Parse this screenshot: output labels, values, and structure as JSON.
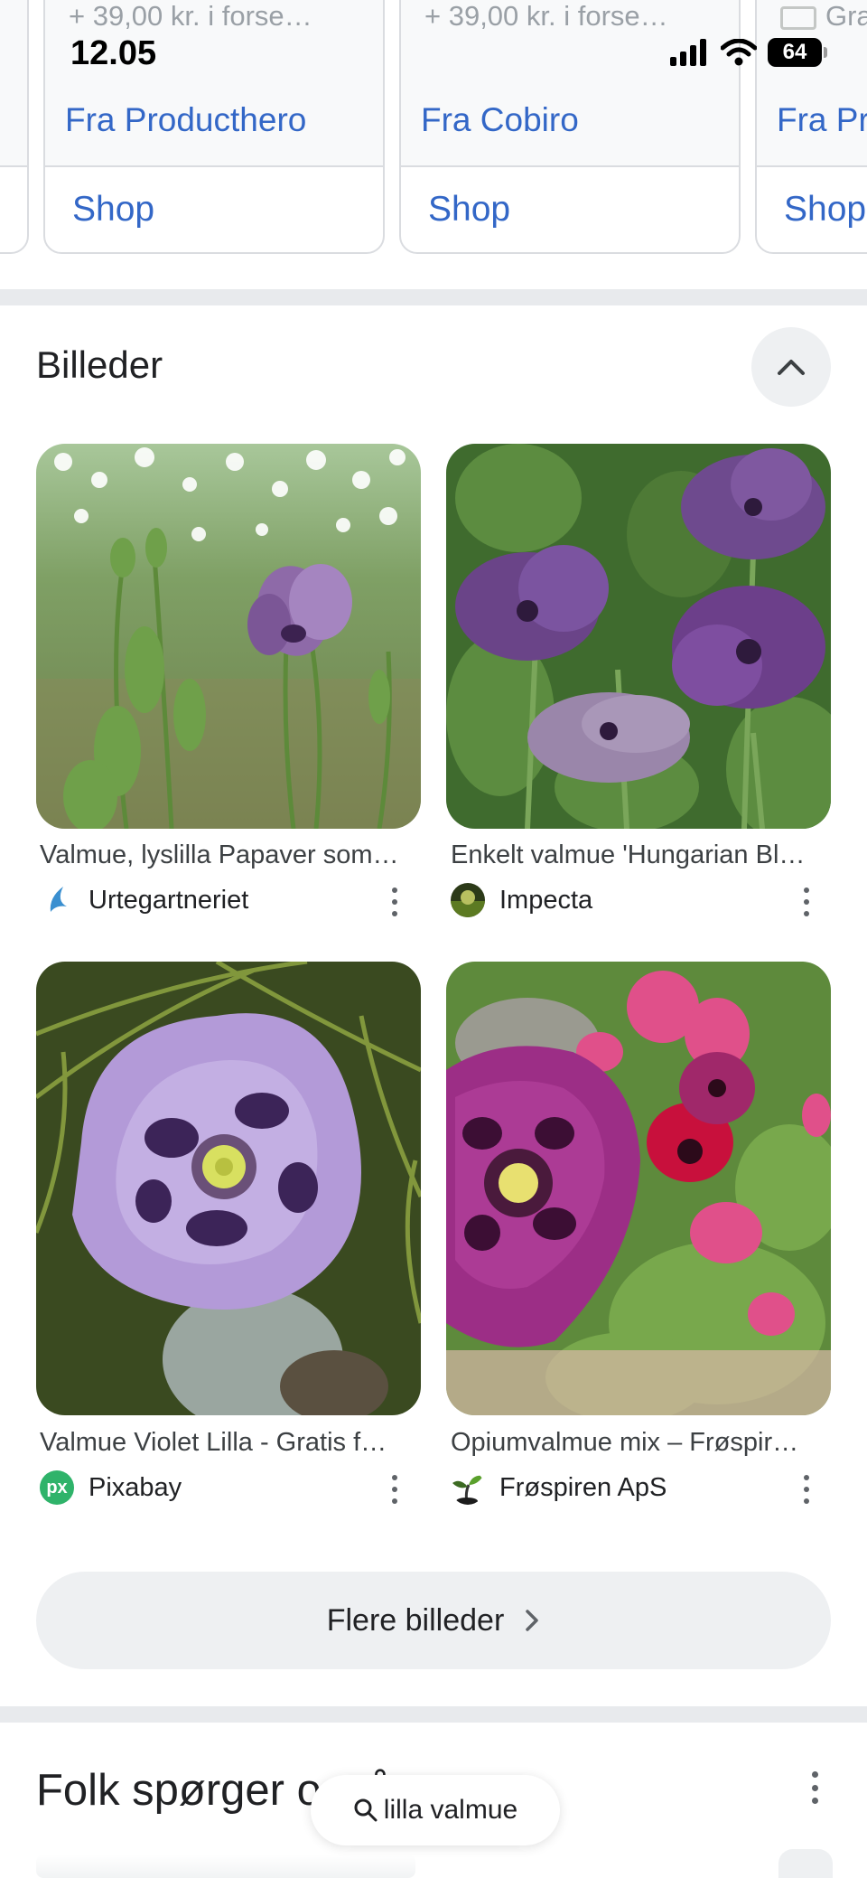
{
  "status_bar": {
    "time": "12.05",
    "battery": "64"
  },
  "shopping": {
    "cards": [
      {
        "price": "+ 39,00 kr. i forse…",
        "source": "Fra Producthero",
        "shop_label": "Shop"
      },
      {
        "price": "+ 39,00 kr. i forse…",
        "source": "Fra Cobiro",
        "shop_label": "Shop"
      },
      {
        "price": "Gra",
        "source": "Fra Pr",
        "shop_label": "Shop"
      }
    ]
  },
  "images_section": {
    "title": "Billeder",
    "items": [
      {
        "caption": "Valmue, lyslilla Papaver som…",
        "source": "Urtegartneriet"
      },
      {
        "caption": "Enkelt valmue 'Hungarian Bl…",
        "source": "Impecta"
      },
      {
        "caption": "Valmue Violet Lilla - Gratis f…",
        "source": "Pixabay"
      },
      {
        "caption": "Opiumvalmue mix – Frøspir…",
        "source": "Frøspiren ApS"
      }
    ],
    "more_label": "Flere billeder",
    "pixabay_logo_text": "px"
  },
  "people_also_ask": {
    "title": "Folk spørger også om"
  },
  "search_pill": {
    "query": "lilla valmue"
  },
  "colors": {
    "link_blue": "#3367c7",
    "divider": "#e8eaed",
    "chip_bg": "#eef0f2"
  }
}
